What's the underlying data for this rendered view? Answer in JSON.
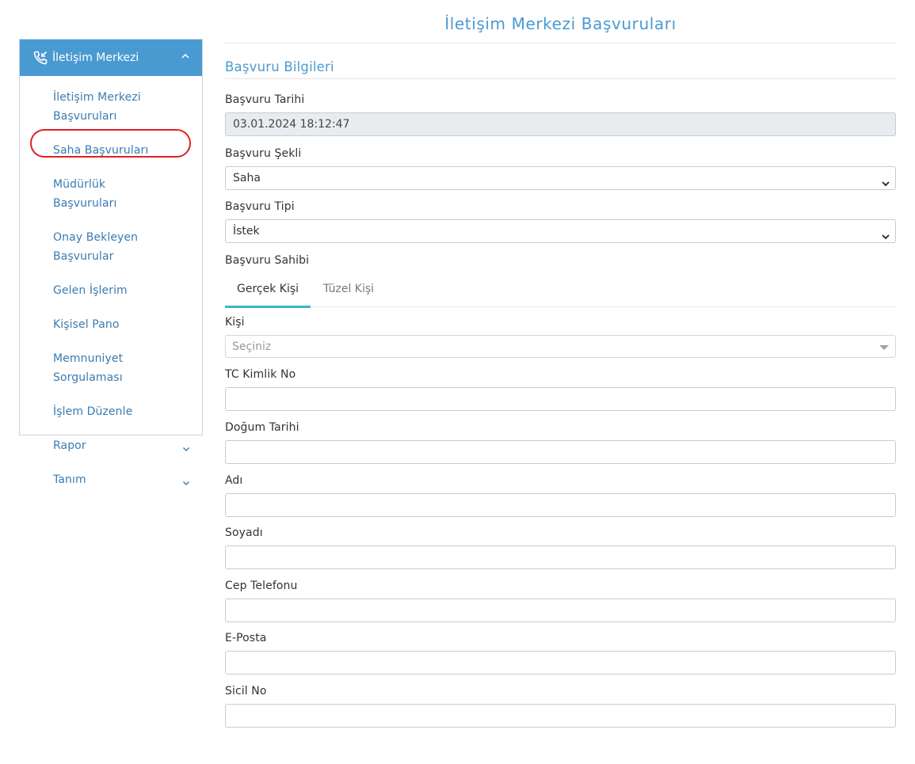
{
  "sidebar": {
    "header": "İletişim Merkezi",
    "items": [
      {
        "label": "İletişim Merkezi Başvuruları"
      },
      {
        "label": "Saha Başvuruları"
      },
      {
        "label": "Müdürlük Başvuruları"
      },
      {
        "label": "Onay Bekleyen Başvurular"
      },
      {
        "label": "Gelen İşlerim"
      },
      {
        "label": "Kişisel Pano"
      },
      {
        "label": "Memnuniyet Sorgulaması"
      },
      {
        "label": "İşlem Düzenle"
      },
      {
        "label": "Rapor"
      },
      {
        "label": "Tanım"
      }
    ]
  },
  "page_title": "İletişim Merkezi Başvuruları",
  "section_title": "Başvuru Bilgileri",
  "form": {
    "basvuru_tarihi": {
      "label": "Başvuru Tarihi",
      "value": "03.01.2024 18:12:47"
    },
    "basvuru_sekli": {
      "label": "Başvuru Şekli",
      "value": "Saha"
    },
    "basvuru_tipi": {
      "label": "Başvuru Tipi",
      "value": "İstek"
    },
    "basvuru_sahibi": {
      "label": "Başvuru Sahibi"
    },
    "tabs": [
      "Gerçek Kişi",
      "Tüzel Kişi"
    ],
    "kisi": {
      "label": "Kişi",
      "placeholder": "Seçiniz"
    },
    "tc": {
      "label": "TC Kimlik No",
      "value": ""
    },
    "dogum": {
      "label": "Doğum Tarihi",
      "value": ""
    },
    "adi": {
      "label": "Adı",
      "value": ""
    },
    "soyadi": {
      "label": "Soyadı",
      "value": ""
    },
    "cep": {
      "label": "Cep Telefonu",
      "value": ""
    },
    "eposta": {
      "label": "E-Posta",
      "value": ""
    },
    "sicil": {
      "label": "Sicil No",
      "value": ""
    }
  },
  "colors": {
    "accent": "#4a9ad2",
    "link": "#3b7bb0",
    "tab_underline": "#3ab7c8",
    "highlight": "#e02020"
  }
}
